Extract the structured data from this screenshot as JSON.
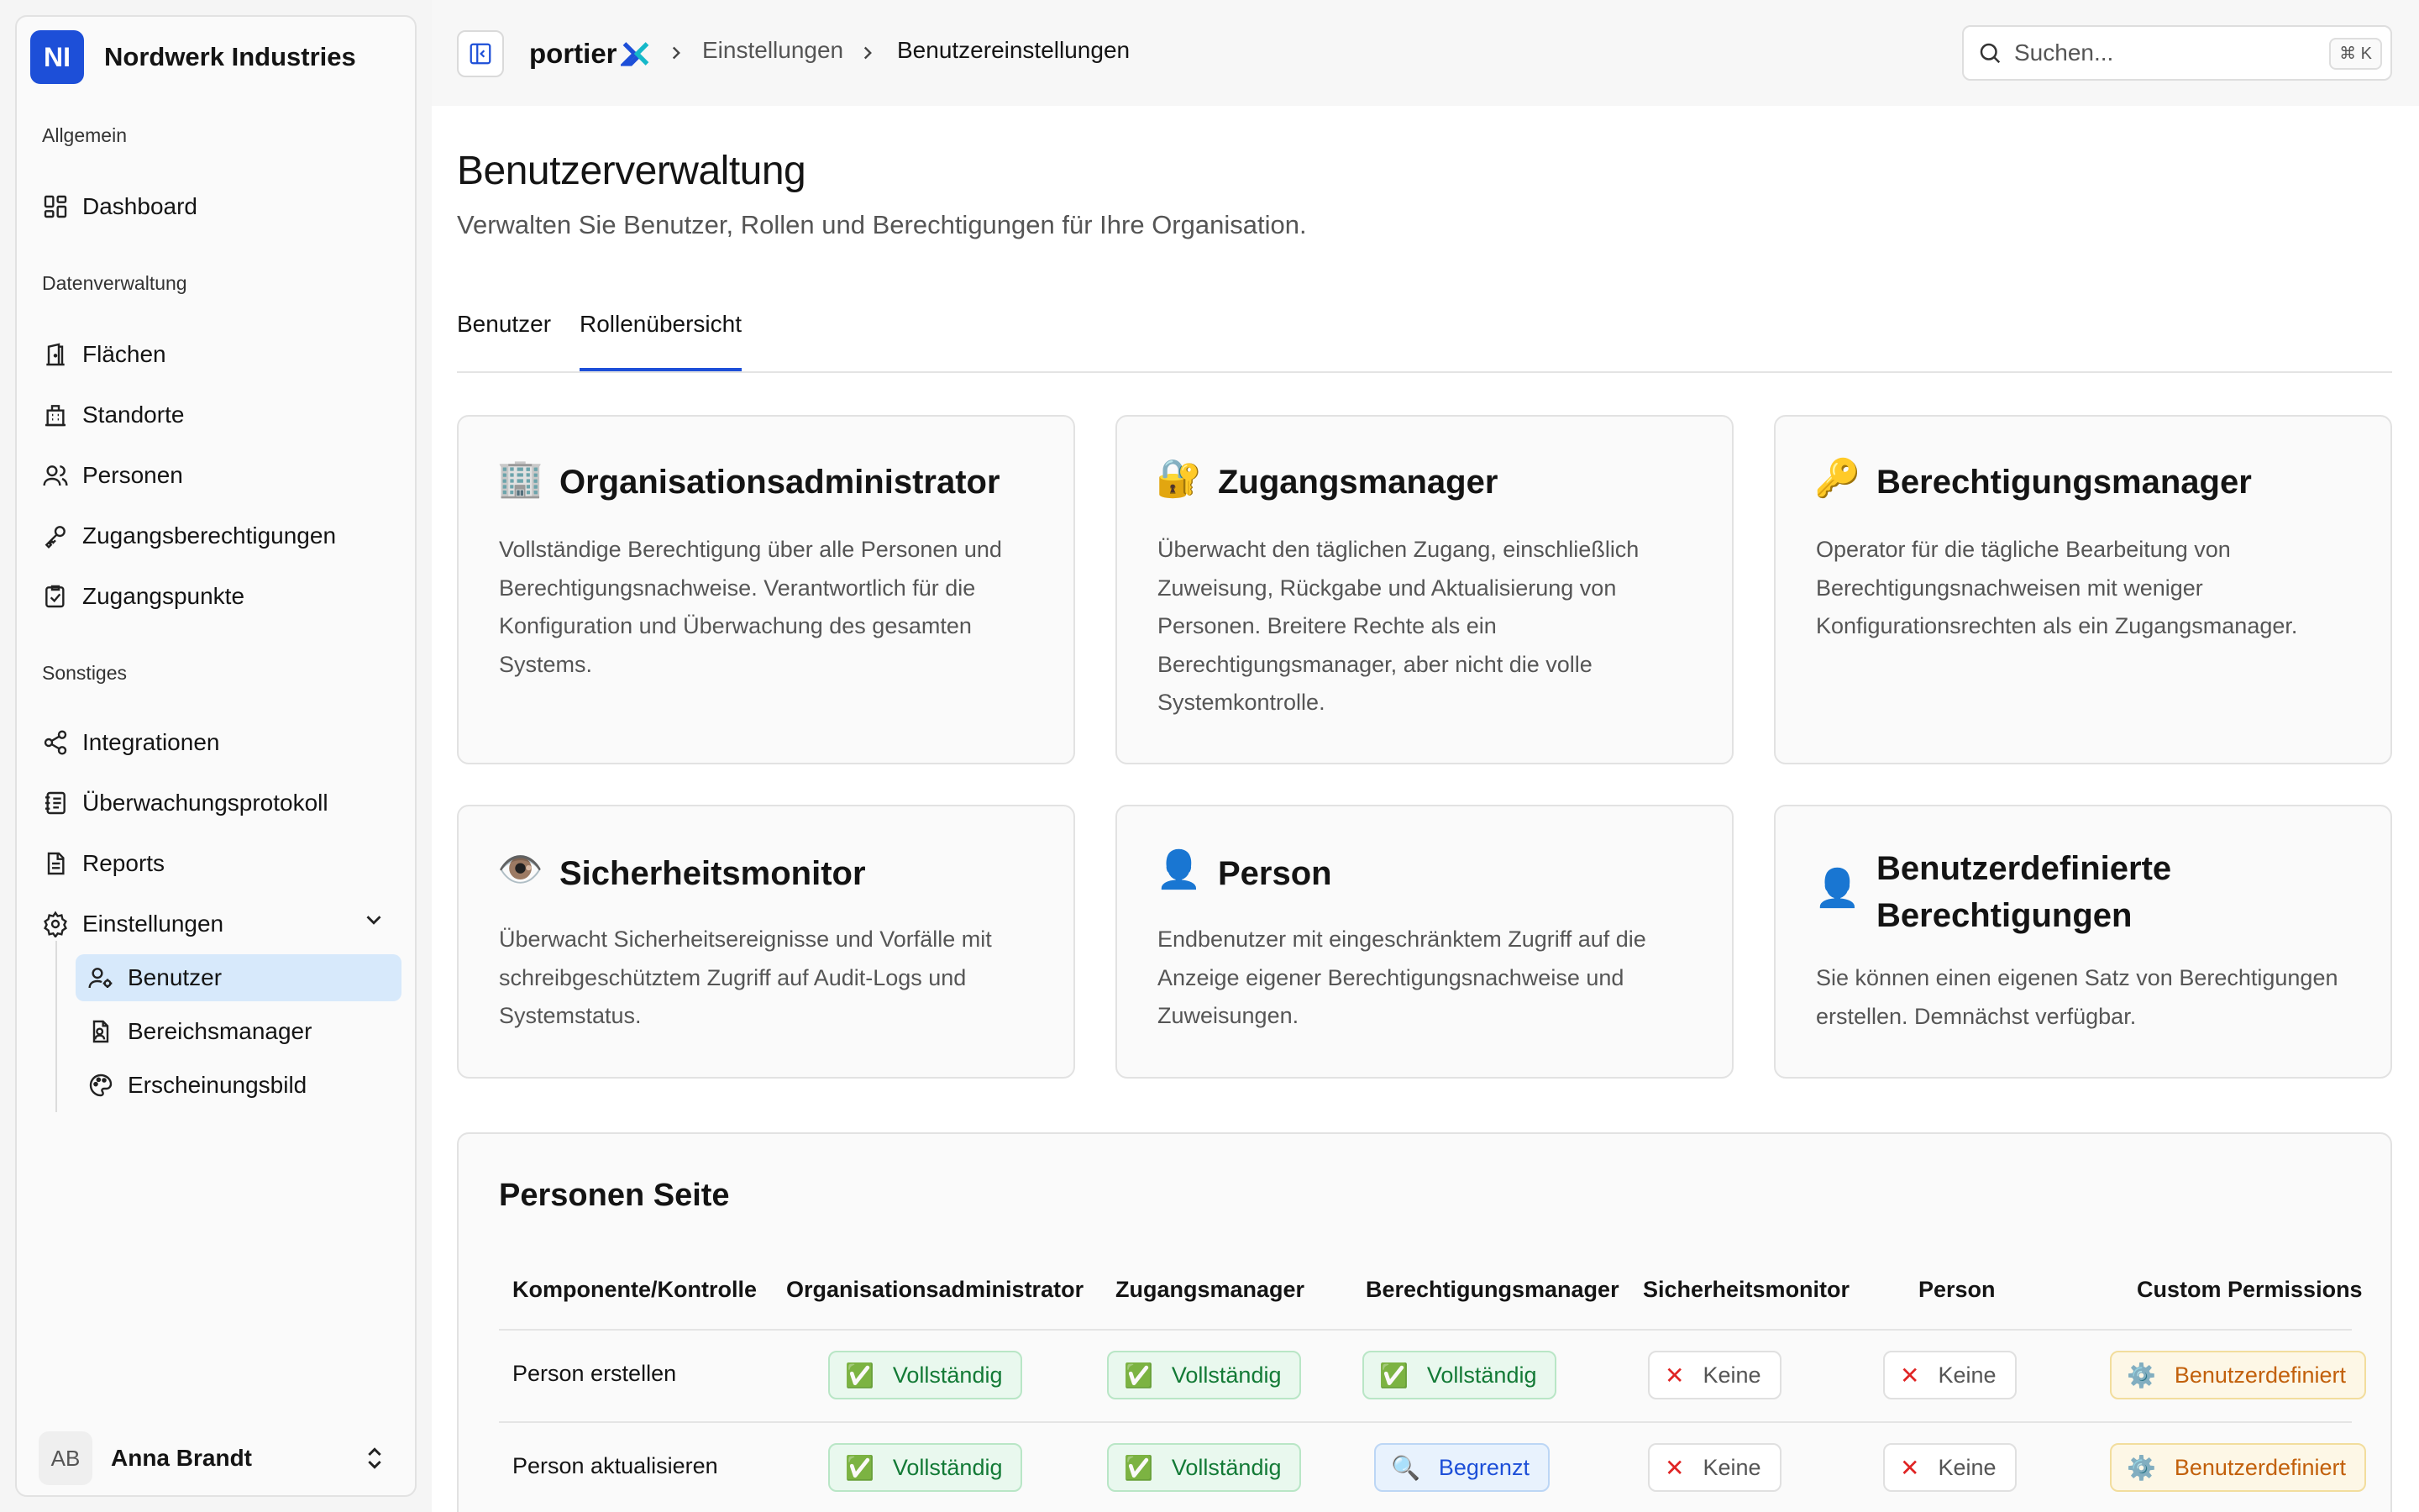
{
  "org": {
    "logo": "NI",
    "name": "Nordwerk Industries"
  },
  "sidebar": {
    "groups": [
      "Allgemein",
      "Datenverwaltung",
      "Sonstiges"
    ],
    "items": {
      "dashboard": "Dashboard",
      "flaechen": "Flächen",
      "standorte": "Standorte",
      "personen": "Personen",
      "zugangsberechtigungen": "Zugangsberechtigungen",
      "zugangspunkte": "Zugangspunkte",
      "integrationen": "Integrationen",
      "protokoll": "Überwachungsprotokoll",
      "reports": "Reports",
      "einstellungen": "Einstellungen",
      "benutzer": "Benutzer",
      "bereichsmanager": "Bereichsmanager",
      "erscheinungsbild": "Erscheinungsbild"
    },
    "user": {
      "initials": "AB",
      "name": "Anna Brandt"
    }
  },
  "topbar": {
    "brand": "portier",
    "breadcrumbs": [
      "Einstellungen",
      "Benutzereinstellungen"
    ],
    "search_placeholder": "Suchen...",
    "search_shortcut": "⌘ K"
  },
  "page": {
    "title": "Benutzerverwaltung",
    "subtitle": "Verwalten Sie Benutzer, Rollen und Berechtigungen für Ihre Organisation.",
    "tabs": [
      "Benutzer",
      "Rollenübersicht"
    ],
    "active_tab": "Rollenübersicht"
  },
  "roles": [
    {
      "emoji": "🏢",
      "title": "Organisationsadministrator",
      "desc": "Vollständige Berechtigung über alle Personen und Berechtigungsnachweise. Verantwortlich für die Konfiguration und Überwachung des gesamten Systems."
    },
    {
      "emoji": "🔐",
      "title": "Zugangsmanager",
      "desc": "Überwacht den täglichen Zugang, einschließlich Zuweisung, Rückgabe und Aktualisierung von Personen. Breitere Rechte als ein Berechtigungsmanager, aber nicht die volle Systemkontrolle."
    },
    {
      "emoji": "🔑",
      "title": "Berechtigungsmanager",
      "desc": "Operator für die tägliche Bearbeitung von Berechtigungsnachweisen mit weniger Konfigurationsrechten als ein Zugangsmanager."
    },
    {
      "emoji": "👁️",
      "title": "Sicherheitsmonitor",
      "desc": "Überwacht Sicherheitsereignisse und Vorfälle mit schreibgeschütztem Zugriff auf Audit-Logs und Systemstatus."
    },
    {
      "emoji": "👤",
      "title": "Person",
      "desc": "Endbenutzer mit eingeschränktem Zugriff auf die Anzeige eigener Berechtigungsnachweise und Zuweisungen."
    },
    {
      "emoji": "👤",
      "title": "Benutzerdefinierte Berechtigungen",
      "desc": "Sie können einen eigenen Satz von Berechtigungen erstellen. Demnächst verfügbar."
    }
  ],
  "table": {
    "title": "Personen Seite",
    "headers": [
      "Komponente/Kontrolle",
      "Organisationsadministrator",
      "Zugangsmanager",
      "Berechtigungsmanager",
      "Sicherheitsmonitor",
      "Person",
      "Custom Permissions"
    ],
    "rows": [
      {
        "label": "Person erstellen",
        "cells": [
          {
            "kind": "full",
            "icon": "✅",
            "text": "Vollständig"
          },
          {
            "kind": "full",
            "icon": "✅",
            "text": "Vollständig"
          },
          {
            "kind": "full",
            "icon": "✅",
            "text": "Vollständig"
          },
          {
            "kind": "none",
            "icon": "✕",
            "text": "Keine"
          },
          {
            "kind": "none",
            "icon": "✕",
            "text": "Keine"
          },
          {
            "kind": "cust",
            "icon": "⚙️",
            "text": "Benutzerdefiniert"
          }
        ]
      },
      {
        "label": "Person aktualisieren",
        "cells": [
          {
            "kind": "full",
            "icon": "✅",
            "text": "Vollständig"
          },
          {
            "kind": "full",
            "icon": "✅",
            "text": "Vollständig"
          },
          {
            "kind": "lim",
            "icon": "🔍",
            "text": "Begrenzt"
          },
          {
            "kind": "none",
            "icon": "✕",
            "text": "Keine"
          },
          {
            "kind": "none",
            "icon": "✕",
            "text": "Keine"
          },
          {
            "kind": "cust",
            "icon": "⚙️",
            "text": "Benutzerdefiniert"
          }
        ]
      }
    ]
  },
  "colors": {
    "accent": "#1d4fd8",
    "active_nav": "#d7e9fb",
    "full": "#137a36",
    "none": "#e02424",
    "limited": "#1d4fd8",
    "custom": "#c2600b"
  }
}
